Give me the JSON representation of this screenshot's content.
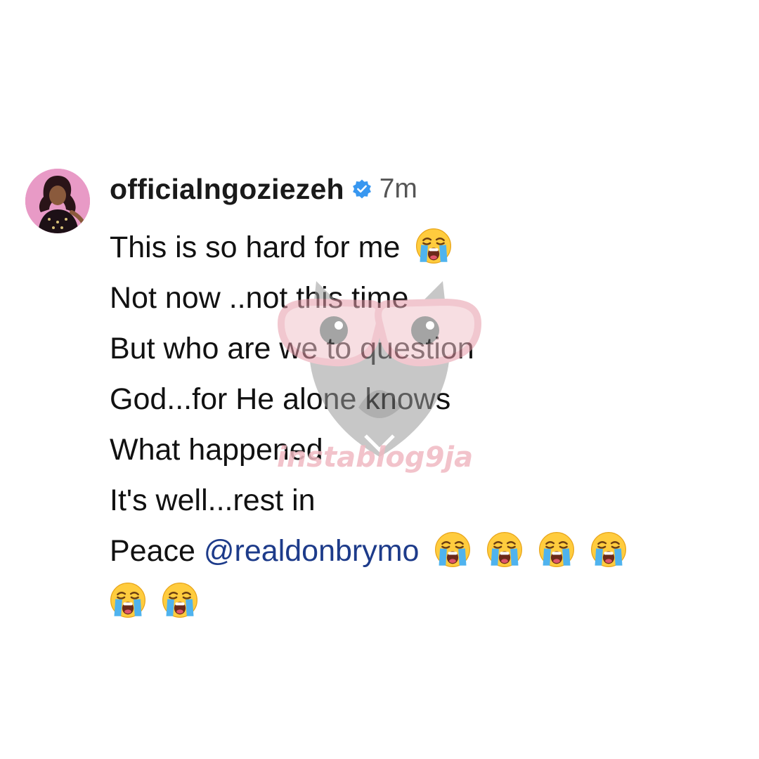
{
  "post": {
    "username": "officialngoziezeh",
    "verified": true,
    "timestamp": "7m",
    "avatar_icon": "profile-photo",
    "lines": {
      "l1": "This is so hard for me",
      "l2": "Not now ..not this time",
      "l3": "But who are we to question",
      "l4": "God...for He alone knows",
      "l5": "What happened",
      "l6": "It's well...rest in",
      "l7_prefix": "Peace",
      "mention": "@realdonbrymo"
    },
    "emoji_icon": "loudly-crying-face-emoji"
  },
  "watermark": {
    "text": "instablog9ja"
  },
  "colors": {
    "verified_badge": "#3897f0",
    "mention": "#1d3b8a",
    "watermark_pink": "#f0b9c2"
  }
}
